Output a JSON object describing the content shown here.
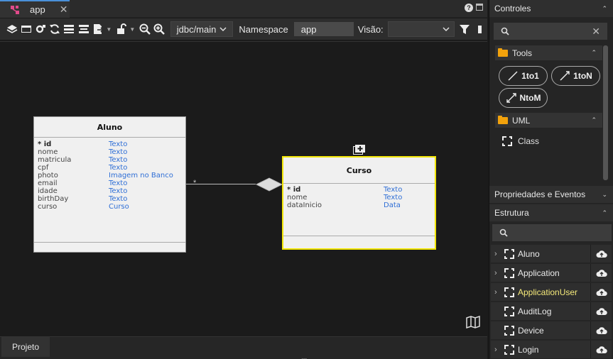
{
  "tab": {
    "label": "app",
    "close": "✕"
  },
  "toolbar": {
    "branch": "jdbc/main",
    "namespace_label": "Namespace",
    "namespace_value": "app",
    "visao_label": "Visão:",
    "visao_value": ""
  },
  "canvas": {
    "entities": [
      {
        "name": "Aluno",
        "attributes": [
          {
            "name": "* id",
            "type": "Texto",
            "pk": true
          },
          {
            "name": "nome",
            "type": "Texto"
          },
          {
            "name": "matricula",
            "type": "Texto"
          },
          {
            "name": "cpf",
            "type": "Texto"
          },
          {
            "name": "photo",
            "type": "Imagem no Banco"
          },
          {
            "name": "email",
            "type": "Texto"
          },
          {
            "name": "idade",
            "type": "Texto"
          },
          {
            "name": "birthDay",
            "type": "Texto"
          },
          {
            "name": "curso",
            "type": "Curso"
          }
        ]
      },
      {
        "name": "Curso",
        "selected": true,
        "attributes": [
          {
            "name": "* id",
            "type": "Texto",
            "pk": true
          },
          {
            "name": "nome",
            "type": "Texto"
          },
          {
            "name": "dataInicio",
            "type": "Data"
          }
        ]
      }
    ],
    "relation": {
      "multiplicity": "*"
    }
  },
  "bottom": {
    "projeto_tab": "Projeto"
  },
  "right_panel": {
    "controles": {
      "title": "Controles",
      "search_placeholder": ""
    },
    "tools": {
      "title": "Tools",
      "buttons": [
        "1to1",
        "1toN",
        "NtoM"
      ]
    },
    "uml": {
      "title": "UML",
      "items": [
        "Class"
      ]
    },
    "propriedades": {
      "title": "Propriedades e Eventos"
    },
    "estrutura": {
      "title": "Estrutura",
      "items": [
        {
          "label": "Aluno",
          "expandable": true,
          "highlight": false
        },
        {
          "label": "Application",
          "expandable": true,
          "highlight": false
        },
        {
          "label": "ApplicationUser",
          "expandable": true,
          "highlight": true
        },
        {
          "label": "AuditLog",
          "expandable": false,
          "highlight": false
        },
        {
          "label": "Device",
          "expandable": false,
          "highlight": false
        },
        {
          "label": "Login",
          "expandable": true,
          "highlight": false
        }
      ]
    }
  },
  "colors": {
    "accent_tab": "#4a90d9",
    "selection": "#f2e600",
    "type_link": "#2f6fd6",
    "folder": "#f2a20c",
    "highlight_item": "#f5e97a"
  }
}
